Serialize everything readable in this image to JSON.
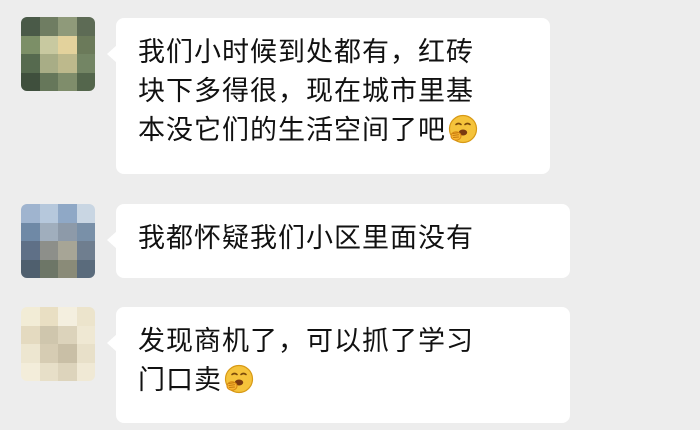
{
  "chat": {
    "messages": [
      {
        "lines": [
          "我们小时候到处都有，红砖",
          "块下多得很，现在城市里基",
          "本没它们的生活空间了吧"
        ],
        "emoji": "shy-laugh-emoji",
        "avatar_colors": [
          "#4a5a48",
          "#6f7d62",
          "#8f9a7a",
          "#5d6b55",
          "#7c8f67",
          "#c8c9a0",
          "#e3d29c",
          "#6b7a5a",
          "#566a4f",
          "#a8ad86",
          "#bdb98c",
          "#738564",
          "#3f4f3d",
          "#66775a",
          "#7f8d6b",
          "#54664c"
        ]
      },
      {
        "lines": [
          "我都怀疑我们小区里面没有"
        ],
        "avatar_colors": [
          "#9fb4cf",
          "#b6c8dc",
          "#8fa8c6",
          "#c9d6e3",
          "#6f89a6",
          "#a0aebd",
          "#8d9aa9",
          "#7990a8",
          "#5f7087",
          "#8d8f8a",
          "#a7a596",
          "#6f7e8f",
          "#4f5f6e",
          "#6d7667",
          "#8a8b78",
          "#5a6b7c"
        ]
      },
      {
        "lines": [
          "发现商机了，可以抓了学习",
          "门口卖"
        ],
        "emoji": "shy-laugh-emoji",
        "avatar_colors": [
          "#f2ecd6",
          "#e9dfc3",
          "#f4efdf",
          "#ece4cc",
          "#e4dac0",
          "#cfc6ad",
          "#dcd3bb",
          "#efe8d3",
          "#ede6d0",
          "#d6ccb3",
          "#c9bfa6",
          "#e8e0c9",
          "#f3edda",
          "#e7dfc8",
          "#ddd4bc",
          "#f0e9d5"
        ]
      }
    ]
  }
}
